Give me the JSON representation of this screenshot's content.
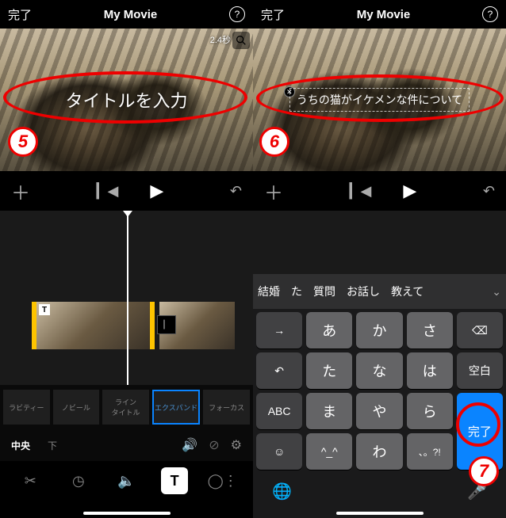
{
  "left": {
    "done": "完了",
    "title": "My Movie",
    "duration": "2.4秒",
    "titlePlaceholder": "タイトルを入力",
    "styles": [
      "ラビティー",
      "ノビール",
      "ライン\nタイトル",
      "エクスパンド",
      "フォーカス"
    ],
    "alignCenter": "中央",
    "alignBottom": "下",
    "step": "5"
  },
  "right": {
    "done": "完了",
    "title": "My Movie",
    "titleValue": "うちの猫がイケメンな件について",
    "suggestions": [
      "結婚",
      "た",
      "質問",
      "お話し",
      "教えて"
    ],
    "keys": {
      "r1": [
        "あ",
        "か",
        "さ"
      ],
      "r2": [
        "た",
        "な",
        "は"
      ],
      "r3": [
        "ま",
        "や",
        "ら"
      ],
      "r4": [
        "^_^",
        "わ",
        "、。?!"
      ]
    },
    "abc": "ABC",
    "space": "空白",
    "doneKey": "完了",
    "step6": "6",
    "step7": "7"
  }
}
